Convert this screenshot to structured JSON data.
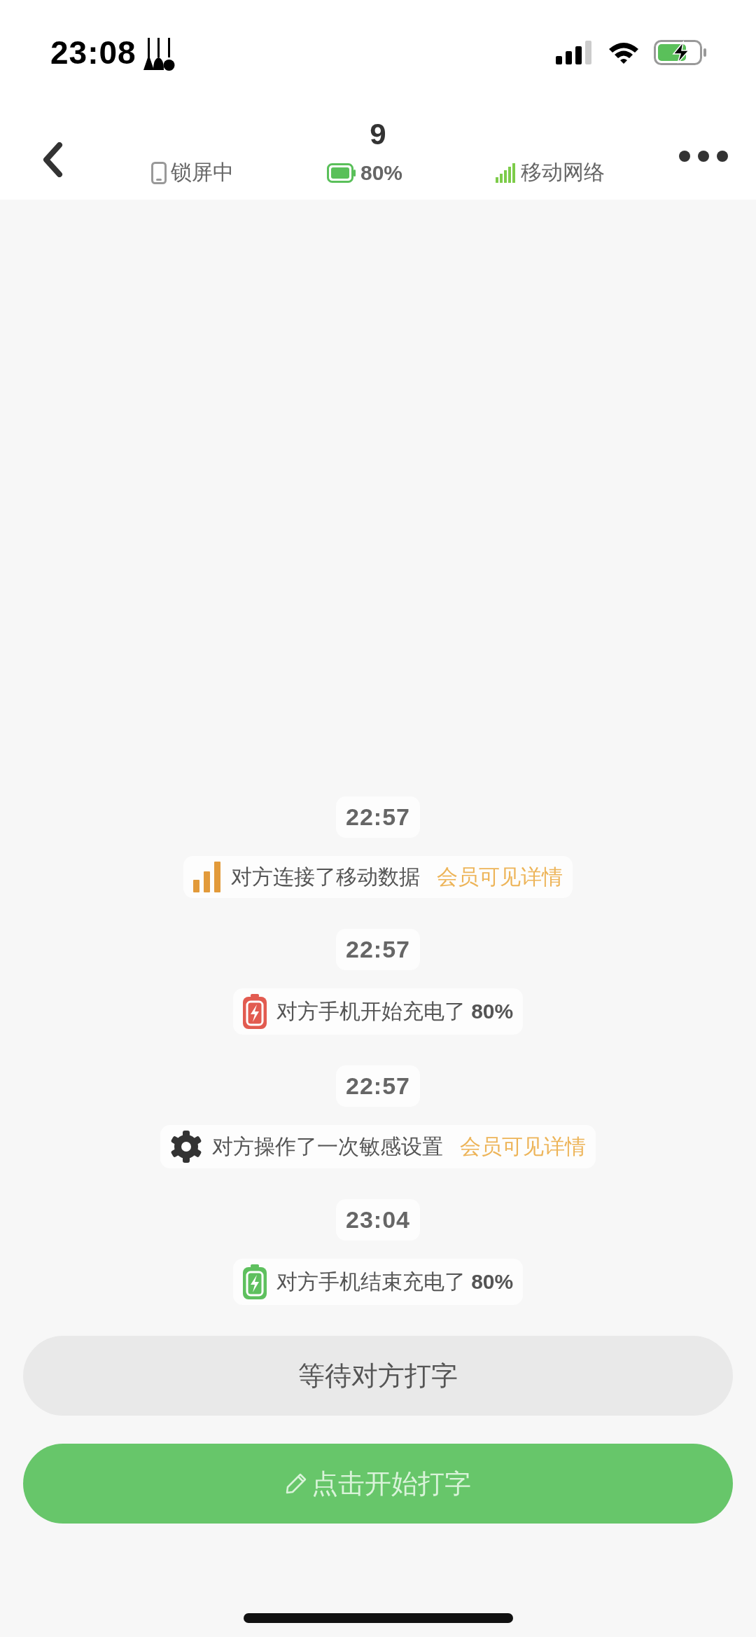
{
  "status_bar": {
    "time": "23:08"
  },
  "header": {
    "title": "9",
    "status_items": [
      {
        "kind": "lock",
        "text": "锁屏中"
      },
      {
        "kind": "battery",
        "text": "80%"
      },
      {
        "kind": "network",
        "text": "移动网络"
      }
    ]
  },
  "events": [
    {
      "time": "22:57",
      "kind": "network",
      "text": "对方连接了移动数据",
      "link": "会员可见详情"
    },
    {
      "time": "22:57",
      "kind": "charge_start",
      "text": "对方手机开始充电了 **80%**"
    },
    {
      "time": "22:57",
      "kind": "settings",
      "text": "对方操作了一次敏感设置",
      "link": "会员可见详情"
    },
    {
      "time": "23:04",
      "kind": "charge_end",
      "text": "对方手机结束充电了 **80%**"
    }
  ],
  "buttons": [
    {
      "kind": "waiting",
      "label": "等待对方打字"
    },
    {
      "kind": "primary",
      "label": "点击开始打字"
    }
  ]
}
